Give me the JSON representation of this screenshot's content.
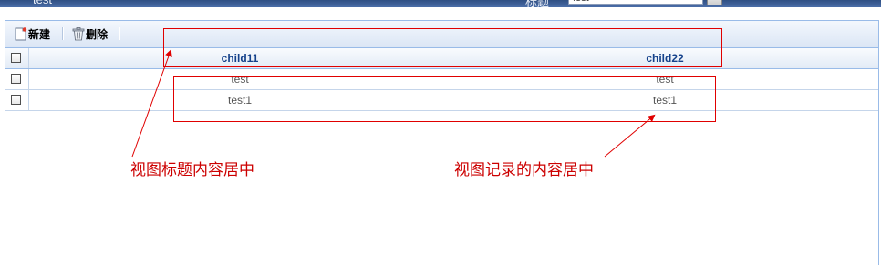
{
  "window": {
    "title": "test",
    "search_label": "标题",
    "search_value": "test"
  },
  "toolbar": {
    "new_label": "新建",
    "delete_label": "删除"
  },
  "grid": {
    "columns": [
      "child11",
      "child22"
    ],
    "rows": [
      [
        "test",
        "test"
      ],
      [
        "test1",
        "test1"
      ]
    ]
  },
  "annotations": {
    "header_note": "视图标题内容居中",
    "record_note": "视图记录的内容居中",
    "color": "#cc0000"
  }
}
